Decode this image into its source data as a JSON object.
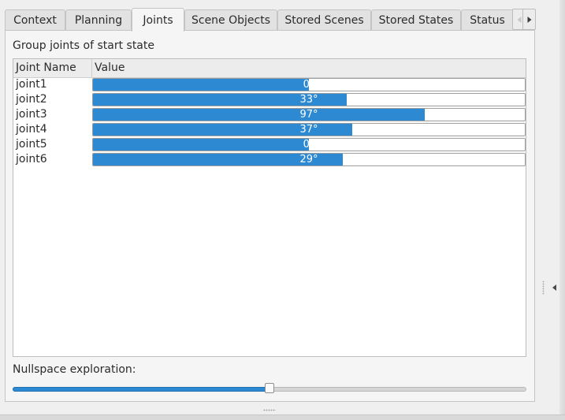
{
  "tabs": [
    {
      "label": "Context",
      "active": false
    },
    {
      "label": "Planning",
      "active": false
    },
    {
      "label": "Joints",
      "active": true
    },
    {
      "label": "Scene Objects",
      "active": false
    },
    {
      "label": "Stored Scenes",
      "active": false
    },
    {
      "label": "Stored States",
      "active": false
    },
    {
      "label": "Status",
      "active": false
    }
  ],
  "group_label": "Group joints of start state",
  "table": {
    "headers": {
      "name": "Joint Name",
      "value": "Value"
    },
    "rows": [
      {
        "name": "joint1",
        "value": "0°",
        "fraction": 0.5
      },
      {
        "name": "joint2",
        "value": "33°",
        "fraction": 0.587
      },
      {
        "name": "joint3",
        "value": "97°",
        "fraction": 0.769
      },
      {
        "name": "joint4",
        "value": "37°",
        "fraction": 0.6
      },
      {
        "name": "joint5",
        "value": "0°",
        "fraction": 0.5
      },
      {
        "name": "joint6",
        "value": "29°",
        "fraction": 0.578
      }
    ]
  },
  "nullspace": {
    "label": "Nullspace exploration:",
    "value_fraction": 0.5
  },
  "icons": {
    "tab_scroll_left": "chevron-left-icon",
    "tab_scroll_right": "chevron-right-icon",
    "dock_collapse": "chevron-left-icon"
  },
  "colors": {
    "accent": "#2d89d2",
    "panel": "#f5f5f5",
    "background": "#efefef"
  }
}
